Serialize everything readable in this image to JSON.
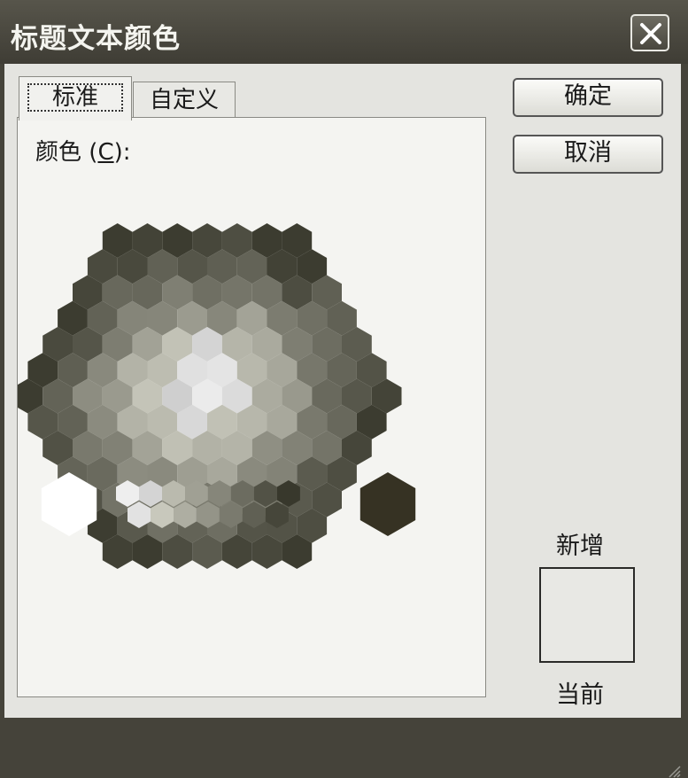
{
  "window": {
    "title": "标题文本颜色"
  },
  "tabs": [
    {
      "label": "标准",
      "active": true
    },
    {
      "label": "自定义",
      "active": false
    }
  ],
  "panel": {
    "color_label": "颜色",
    "color_shortcut": "C",
    "color_suffix": ":"
  },
  "buttons": {
    "ok": "确定",
    "cancel": "取消"
  },
  "preview": {
    "new_label": "新增",
    "current_label": "当前",
    "current_color": "#e8e8e4"
  },
  "icons": {
    "close": "close-icon",
    "grip": "resize-grip-icon"
  }
}
